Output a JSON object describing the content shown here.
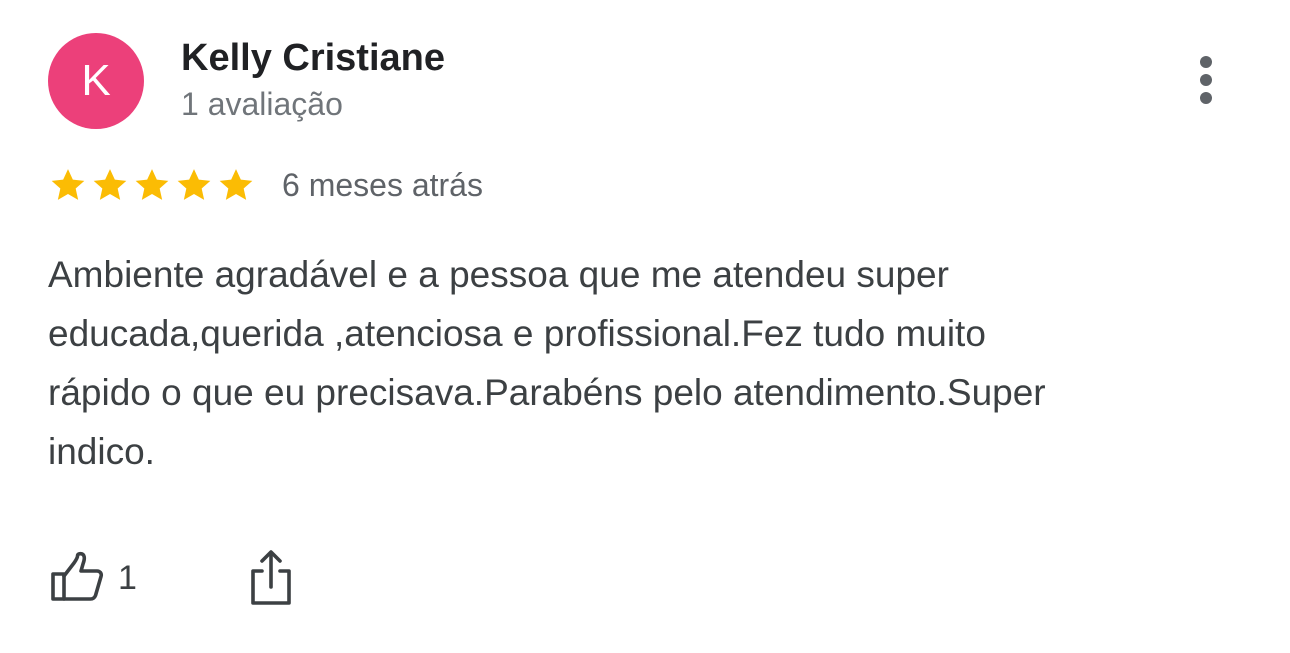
{
  "reviewer": {
    "name": "Kelly Cristiane",
    "initial": "K",
    "review_count": "1 avaliação",
    "avatar_color": "#ec407a"
  },
  "menu": {
    "icon": "more-vert-icon"
  },
  "rating": {
    "stars": 5,
    "max_stars": 5,
    "star_color": "#fbbc04",
    "date": "6 meses atrás"
  },
  "review": {
    "lines": [
      "Ambiente agradável e a pessoa que me atendeu super",
      "educada,querida ,atenciosa e profissional.Fez tudo muito",
      "rápido o que eu precisava.Parabéns pelo atendimento.Super",
      "indico."
    ]
  },
  "actions": {
    "like_icon": "thumb-up-icon",
    "like_count": "1",
    "share_icon": "share-icon"
  }
}
